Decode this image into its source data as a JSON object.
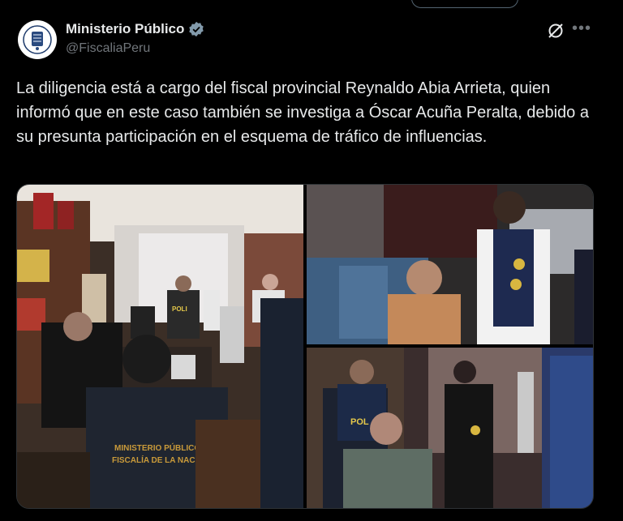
{
  "author": {
    "name": "Ministerio Público",
    "handle": "@FiscaliaPeru",
    "verified": true,
    "badge_color": "#829aab"
  },
  "actions": {
    "grok_icon": "grok-icon",
    "more_icon": "more-icon",
    "more_label": "•••"
  },
  "tweet": {
    "text": "La diligencia está a cargo del fiscal provincial Reynaldo Abia Arrieta, quien informó que en este caso también se investiga a Óscar Acuña Peralta, debido a su presunta participación en el esquema de tráfico de influencias."
  },
  "media": {
    "photos": [
      {
        "id": "photo-1",
        "vest_text_line1": "MINISTERIO PÚBLICO",
        "vest_text_line2": "FISCALÍA DE LA NACIÓN",
        "vest_badge": "POLI"
      },
      {
        "id": "photo-2"
      },
      {
        "id": "photo-3",
        "vest_badge": "POL"
      }
    ]
  },
  "colors": {
    "background": "#000000",
    "text": "#e7e9ea",
    "muted": "#71767b",
    "border": "#2f3336"
  }
}
